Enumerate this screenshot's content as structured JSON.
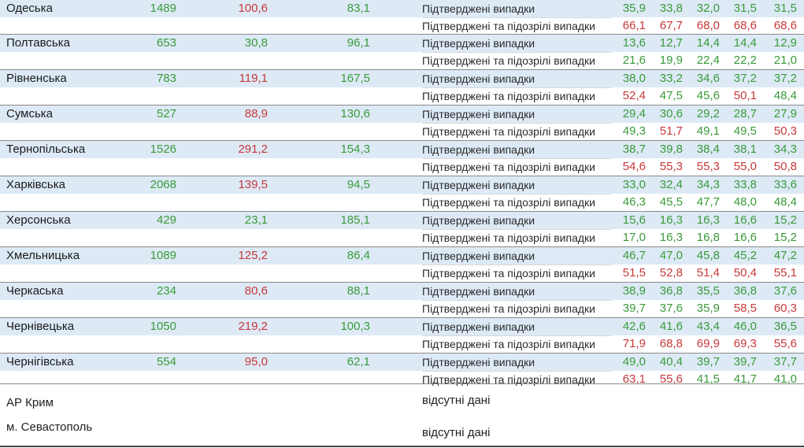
{
  "colors": {
    "green": "#3a9a3a",
    "red": "#c8383a",
    "band": "#ddeaf6"
  },
  "rows": [
    {
      "region": "Одеська",
      "c1": "1489",
      "c1c": "g",
      "c2": "100,6",
      "c2c": "r",
      "c3": "83,1",
      "c3c": "g",
      "confirmed": {
        "label": "Підтверджені випадки",
        "vals": [
          "35,9",
          "33,8",
          "32,0",
          "31,5",
          "31,5"
        ],
        "cols": [
          "g",
          "g",
          "g",
          "g",
          "g"
        ]
      },
      "suspected": {
        "label": "Підтверджені та підозрілі випадки",
        "vals": [
          "66,1",
          "67,7",
          "68,0",
          "68,6",
          "68,6"
        ],
        "cols": [
          "r",
          "r",
          "r",
          "r",
          "r"
        ]
      }
    },
    {
      "region": "Полтавська",
      "c1": "653",
      "c1c": "g",
      "c2": "30,8",
      "c2c": "g",
      "c3": "96,1",
      "c3c": "g",
      "confirmed": {
        "label": "Підтверджені випадки",
        "vals": [
          "13,6",
          "12,7",
          "14,4",
          "14,4",
          "12,9"
        ],
        "cols": [
          "g",
          "g",
          "g",
          "g",
          "g"
        ]
      },
      "suspected": {
        "label": "Підтверджені та підозрілі випадки",
        "vals": [
          "21,6",
          "19,9",
          "22,4",
          "22,2",
          "21,0"
        ],
        "cols": [
          "g",
          "g",
          "g",
          "g",
          "g"
        ]
      }
    },
    {
      "region": "Рівненська",
      "c1": "783",
      "c1c": "g",
      "c2": "119,1",
      "c2c": "r",
      "c3": "167,5",
      "c3c": "g",
      "confirmed": {
        "label": "Підтверджені випадки",
        "vals": [
          "38,0",
          "33,2",
          "34,6",
          "37,2",
          "37,2"
        ],
        "cols": [
          "g",
          "g",
          "g",
          "g",
          "g"
        ]
      },
      "suspected": {
        "label": "Підтверджені та підозрілі випадки",
        "vals": [
          "52,4",
          "47,5",
          "45,6",
          "50,1",
          "48,4"
        ],
        "cols": [
          "r",
          "g",
          "g",
          "r",
          "g"
        ]
      }
    },
    {
      "region": "Сумська",
      "c1": "527",
      "c1c": "g",
      "c2": "88,9",
      "c2c": "r",
      "c3": "130,6",
      "c3c": "g",
      "confirmed": {
        "label": "Підтверджені випадки",
        "vals": [
          "29,4",
          "30,6",
          "29,2",
          "28,7",
          "27,9"
        ],
        "cols": [
          "g",
          "g",
          "g",
          "g",
          "g"
        ]
      },
      "suspected": {
        "label": "Підтверджені та підозрілі випадки",
        "vals": [
          "49,3",
          "51,7",
          "49,1",
          "49,5",
          "50,3"
        ],
        "cols": [
          "g",
          "r",
          "g",
          "g",
          "r"
        ]
      }
    },
    {
      "region": "Тернопільська",
      "c1": "1526",
      "c1c": "g",
      "c2": "291,2",
      "c2c": "r",
      "c3": "154,3",
      "c3c": "g",
      "confirmed": {
        "label": "Підтверджені випадки",
        "vals": [
          "38,7",
          "39,8",
          "38,4",
          "38,1",
          "34,3"
        ],
        "cols": [
          "g",
          "g",
          "g",
          "g",
          "g"
        ]
      },
      "suspected": {
        "label": "Підтверджені та підозрілі випадки",
        "vals": [
          "54,6",
          "55,3",
          "55,3",
          "55,0",
          "50,8"
        ],
        "cols": [
          "r",
          "r",
          "r",
          "r",
          "r"
        ]
      }
    },
    {
      "region": "Харківська",
      "c1": "2068",
      "c1c": "g",
      "c2": "139,5",
      "c2c": "r",
      "c3": "94,5",
      "c3c": "g",
      "confirmed": {
        "label": "Підтверджені випадки",
        "vals": [
          "33,0",
          "32,4",
          "34,3",
          "33,8",
          "33,6"
        ],
        "cols": [
          "g",
          "g",
          "g",
          "g",
          "g"
        ]
      },
      "suspected": {
        "label": "Підтверджені та підозрілі випадки",
        "vals": [
          "46,3",
          "45,5",
          "47,7",
          "48,0",
          "48,4"
        ],
        "cols": [
          "g",
          "g",
          "g",
          "g",
          "g"
        ]
      }
    },
    {
      "region": "Херсонська",
      "c1": "429",
      "c1c": "g",
      "c2": "23,1",
      "c2c": "g",
      "c3": "185,1",
      "c3c": "g",
      "confirmed": {
        "label": "Підтверджені випадки",
        "vals": [
          "15,6",
          "16,3",
          "16,3",
          "16,6",
          "15,2"
        ],
        "cols": [
          "g",
          "g",
          "g",
          "g",
          "g"
        ]
      },
      "suspected": {
        "label": "Підтверджені та підозрілі випадки",
        "vals": [
          "17,0",
          "16,3",
          "16,8",
          "16,6",
          "15,2"
        ],
        "cols": [
          "g",
          "g",
          "g",
          "g",
          "g"
        ]
      }
    },
    {
      "region": "Хмельницька",
      "c1": "1089",
      "c1c": "g",
      "c2": "125,2",
      "c2c": "r",
      "c3": "86,4",
      "c3c": "g",
      "confirmed": {
        "label": "Підтверджені випадки",
        "vals": [
          "46,7",
          "47,0",
          "45,8",
          "45,2",
          "47,2"
        ],
        "cols": [
          "g",
          "g",
          "g",
          "g",
          "g"
        ]
      },
      "suspected": {
        "label": "Підтверджені та підозрілі випадки",
        "vals": [
          "51,5",
          "52,8",
          "51,4",
          "50,4",
          "55,1"
        ],
        "cols": [
          "r",
          "r",
          "r",
          "r",
          "r"
        ]
      }
    },
    {
      "region": "Черкаська",
      "c1": "234",
      "c1c": "g",
      "c2": "80,6",
      "c2c": "r",
      "c3": "88,1",
      "c3c": "g",
      "confirmed": {
        "label": "Підтверджені випадки",
        "vals": [
          "38,9",
          "36,8",
          "35,5",
          "36,8",
          "37,6"
        ],
        "cols": [
          "g",
          "g",
          "g",
          "g",
          "g"
        ]
      },
      "suspected": {
        "label": "Підтверджені та підозрілі випадки",
        "vals": [
          "39,7",
          "37,6",
          "35,9",
          "58,5",
          "60,3"
        ],
        "cols": [
          "g",
          "g",
          "g",
          "r",
          "r"
        ]
      }
    },
    {
      "region": "Чернівецька",
      "c1": "1050",
      "c1c": "g",
      "c2": "219,2",
      "c2c": "r",
      "c3": "100,3",
      "c3c": "g",
      "confirmed": {
        "label": "Підтверджені випадки",
        "vals": [
          "42,6",
          "41,6",
          "43,4",
          "46,0",
          "36,5"
        ],
        "cols": [
          "g",
          "g",
          "g",
          "g",
          "g"
        ]
      },
      "suspected": {
        "label": "Підтверджені та підозрілі випадки",
        "vals": [
          "71,9",
          "68,8",
          "69,9",
          "69,3",
          "55,6"
        ],
        "cols": [
          "r",
          "r",
          "r",
          "r",
          "r"
        ]
      }
    },
    {
      "region": "Чернігівська",
      "c1": "554",
      "c1c": "g",
      "c2": "95,0",
      "c2c": "r",
      "c3": "62,1",
      "c3c": "g",
      "confirmed": {
        "label": "Підтверджені випадки",
        "vals": [
          "49,0",
          "40,4",
          "39,7",
          "39,7",
          "37,7"
        ],
        "cols": [
          "g",
          "g",
          "g",
          "g",
          "g"
        ]
      },
      "suspected": {
        "label": "Підтверджені та підозрілі випадки",
        "vals": [
          "63,1",
          "55,6",
          "41,5",
          "41,7",
          "41,0"
        ],
        "cols": [
          "r",
          "r",
          "g",
          "g",
          "g"
        ]
      }
    }
  ],
  "tail": {
    "crimea": "АР Крим",
    "sevastopol": "м. Севастополь",
    "no_data_1": "відсутні дані",
    "no_data_2": "відсутні дані"
  }
}
